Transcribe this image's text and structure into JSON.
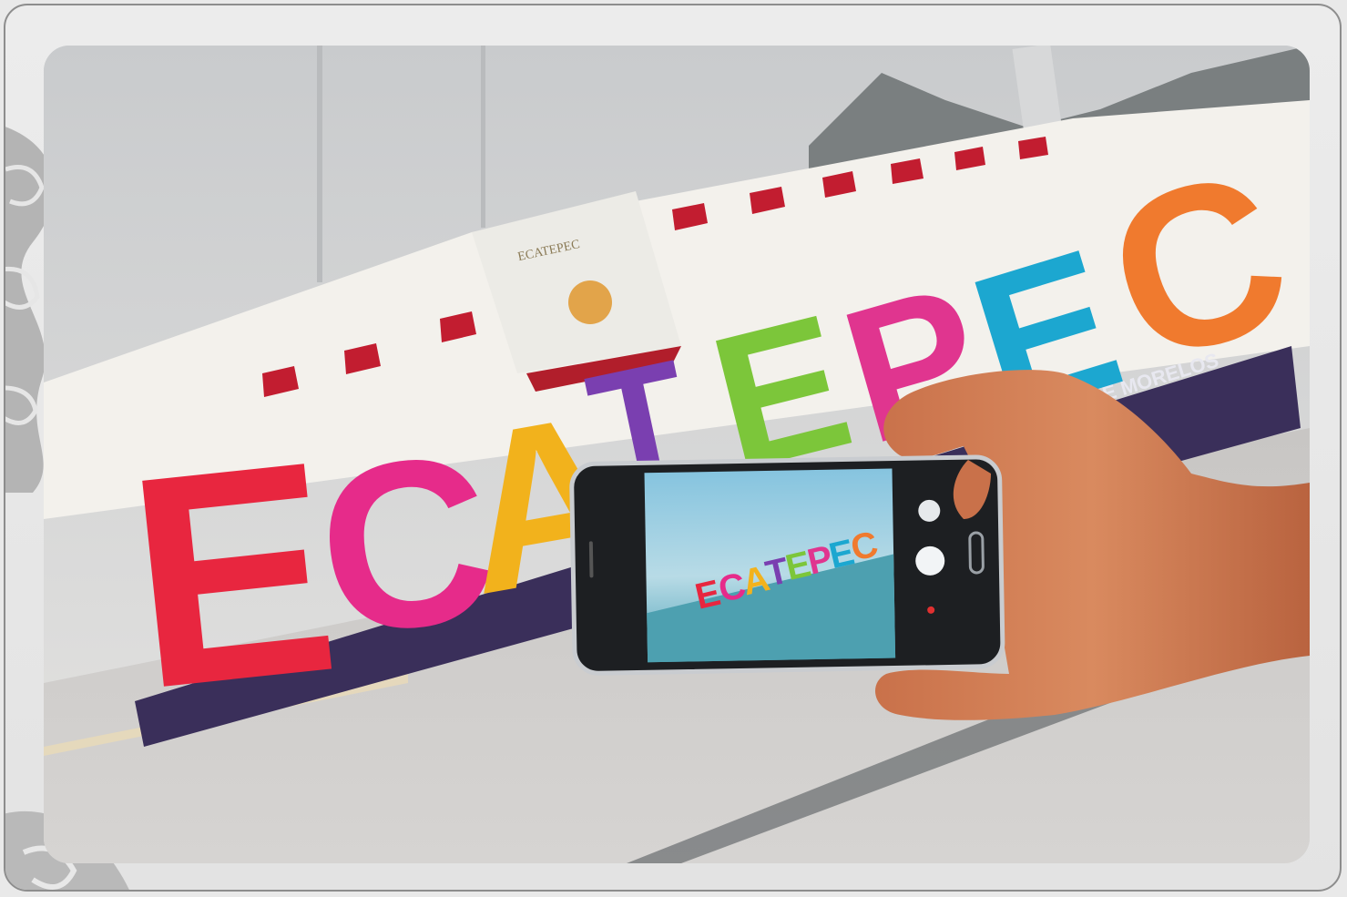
{
  "photo": {
    "sign_letters": [
      "E",
      "C",
      "A",
      "T",
      "E",
      "P",
      "E",
      "C"
    ],
    "sign_subtitle": "DE MORELOS",
    "building_plaque": "ECATEPEC",
    "colors": {
      "red": "#e8263f",
      "magenta": "#e62b8a",
      "yellow": "#f2b21c",
      "purple": "#7a3fb0",
      "green": "#7cc63a",
      "pink": "#e0358f",
      "cyan": "#1ca7d0",
      "orange": "#f07a2e",
      "base": "#3a2f5a",
      "sky": "#d9dadb",
      "wall": "#f3f1ec",
      "awning": "#c21d30"
    }
  }
}
